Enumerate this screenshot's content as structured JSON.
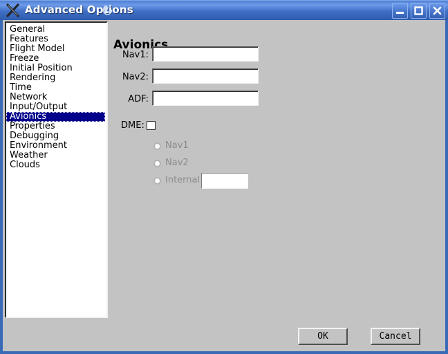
{
  "window": {
    "title": "Advanced Options",
    "app_icon": "x-logo-icon",
    "title_swirl_icon": "swirl-icon",
    "accent_color": "#3a6ab5",
    "titlebar_gradient_top": "#6d9ae8",
    "titlebar_gradient_bottom": "#2f5cae",
    "face_color": "#c3c3c3",
    "selection_color": "#00008b",
    "controls": [
      {
        "name": "minimize",
        "glyph": "minimize-icon"
      },
      {
        "name": "maximize",
        "glyph": "maximize-icon"
      },
      {
        "name": "close",
        "glyph": "close-icon"
      }
    ]
  },
  "sidebar": {
    "selected": "Avionics",
    "items": [
      {
        "label": "General"
      },
      {
        "label": "Features"
      },
      {
        "label": "Flight Model"
      },
      {
        "label": "Freeze"
      },
      {
        "label": "Initial Position"
      },
      {
        "label": "Rendering"
      },
      {
        "label": "Time"
      },
      {
        "label": "Network"
      },
      {
        "label": "Input/Output"
      },
      {
        "label": "Avionics"
      },
      {
        "label": "Properties"
      },
      {
        "label": "Debugging"
      },
      {
        "label": "Environment"
      },
      {
        "label": "Weather"
      },
      {
        "label": "Clouds"
      }
    ]
  },
  "panel": {
    "title": "Avionics",
    "fields": [
      {
        "label": "Nav1:",
        "value": "",
        "placeholder": ""
      },
      {
        "label": "Nav2:",
        "value": "",
        "placeholder": ""
      },
      {
        "label": "ADF:",
        "value": "",
        "placeholder": ""
      }
    ],
    "dme": {
      "label": "DME:",
      "checked": false,
      "options": [
        {
          "label": "Nav1",
          "selected": false,
          "disabled": true
        },
        {
          "label": "Nav2",
          "selected": false,
          "disabled": true
        },
        {
          "label": "Internal",
          "selected": false,
          "disabled": true
        }
      ],
      "internal_value": "",
      "internal_placeholder": ""
    }
  },
  "buttons": {
    "ok": "OK",
    "cancel": "Cancel"
  }
}
